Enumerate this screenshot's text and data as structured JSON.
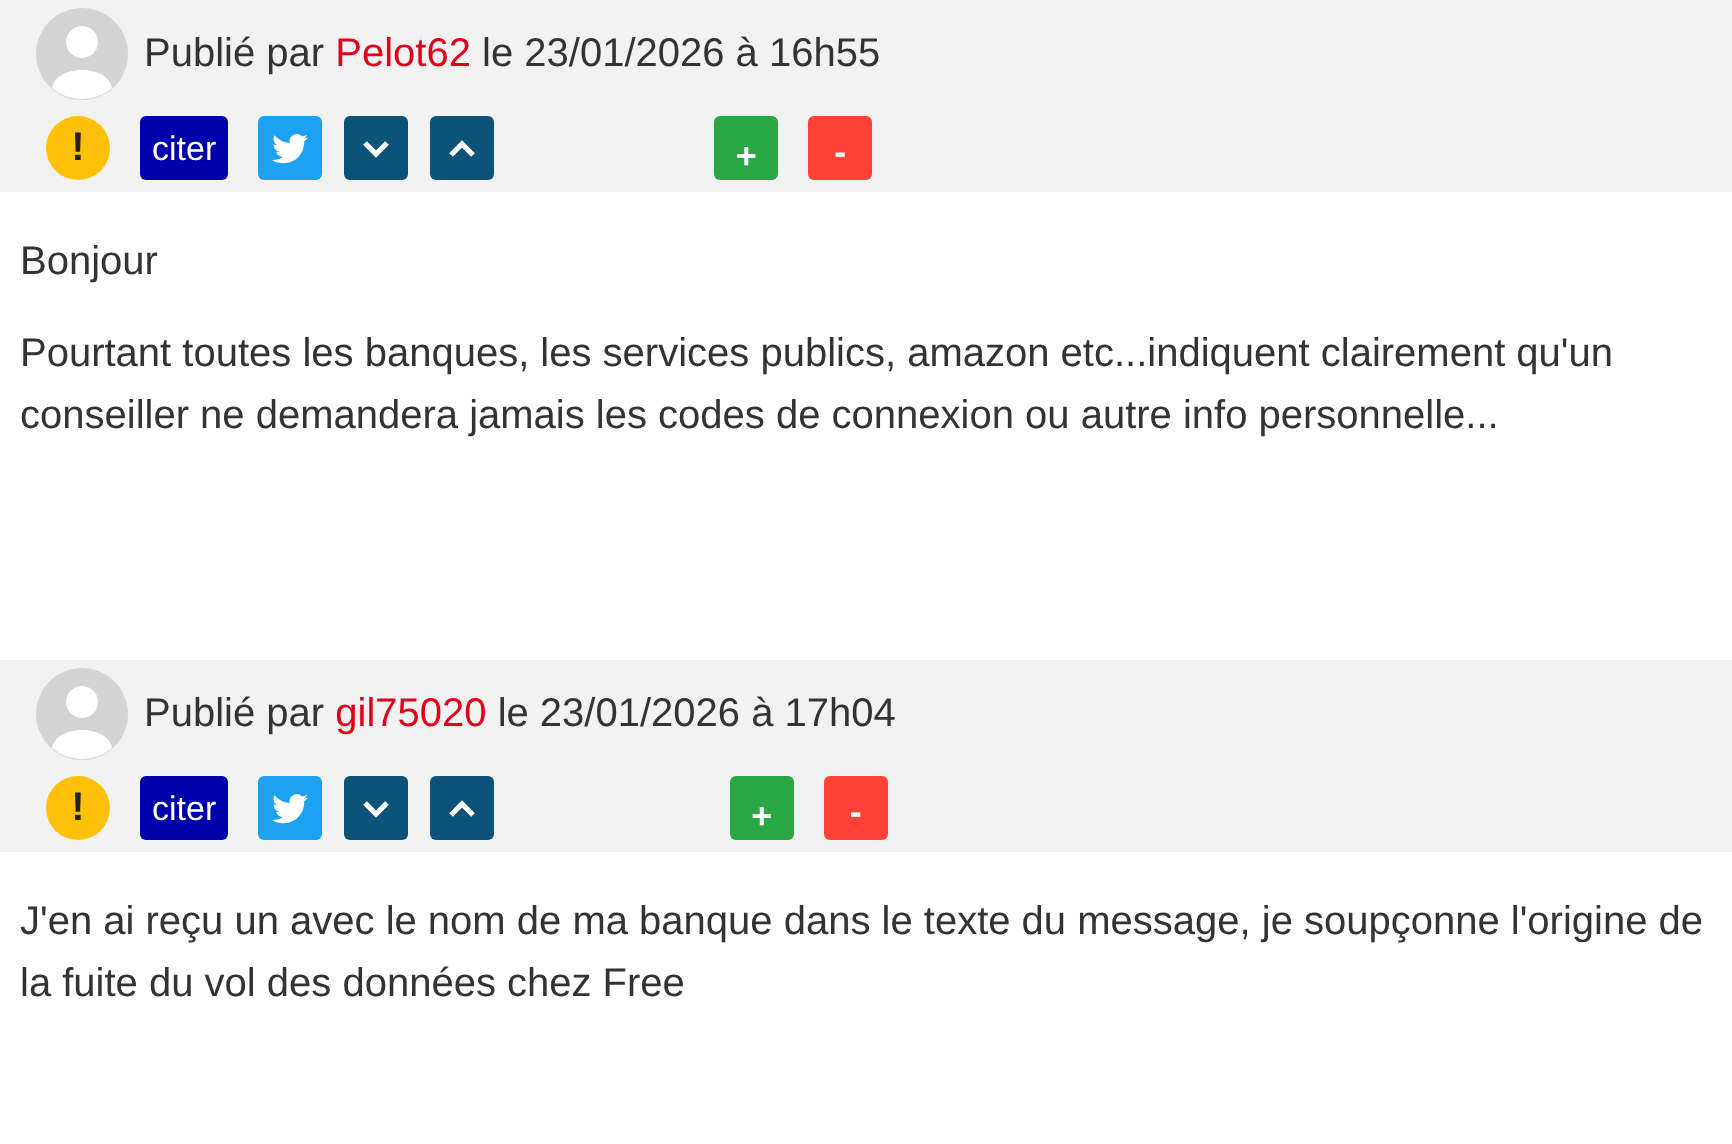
{
  "posts": [
    {
      "published_label": "Publié par",
      "author": "Pelot62",
      "date_text": "le 23/01/2026 à 16h55",
      "actions": {
        "report": "!",
        "quote": "citer",
        "plus": "+",
        "minus": "-"
      },
      "paragraphs": [
        "Bonjour",
        "Pourtant toutes les banques, les services publics, amazon etc...indiquent clairement qu'un conseiller ne demandera jamais les codes de connexion ou autre info personnelle..."
      ]
    },
    {
      "published_label": "Publié par",
      "author": "gil75020",
      "date_text": "le 23/01/2026 à 17h04",
      "actions": {
        "report": "!",
        "quote": "citer",
        "plus": "+",
        "minus": "-"
      },
      "paragraphs": [
        "J'en ai reçu un avec le nom de ma banque dans le texte du message, je soupçonne l'origine de la fuite  du vol des données chez Free"
      ]
    }
  ]
}
